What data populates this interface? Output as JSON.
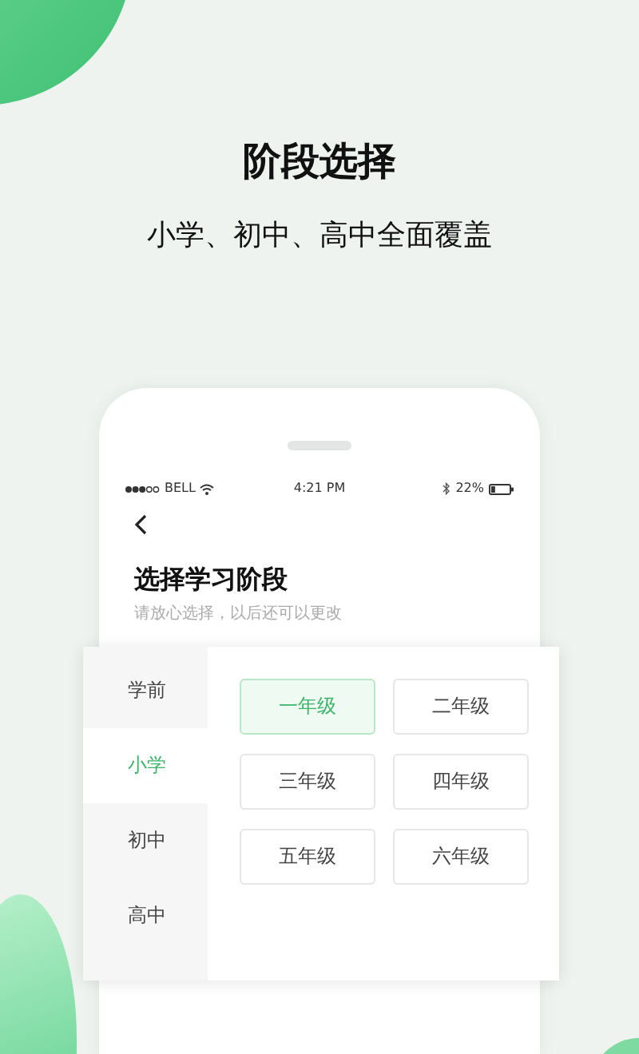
{
  "headline": "阶段选择",
  "tagline": "小学、初中、高中全面覆盖",
  "phone": {
    "status_bar": {
      "carrier": "BELL",
      "time": "4:21 PM",
      "battery": "22%",
      "battery_meter": {
        "level": 0.22
      }
    },
    "heading": "选择学习阶段",
    "hint": "请放心选择，以后还可以更改",
    "stages": [
      {
        "label": "学前",
        "selected": false
      },
      {
        "label": "小学",
        "selected": true
      },
      {
        "label": "初中",
        "selected": false
      },
      {
        "label": "高中",
        "selected": false
      }
    ],
    "grades": [
      {
        "label": "一年级",
        "selected": true
      },
      {
        "label": "二年级",
        "selected": false
      },
      {
        "label": "三年级",
        "selected": false
      },
      {
        "label": "四年级",
        "selected": false
      },
      {
        "label": "五年级",
        "selected": false
      },
      {
        "label": "六年级",
        "selected": false
      }
    ]
  }
}
